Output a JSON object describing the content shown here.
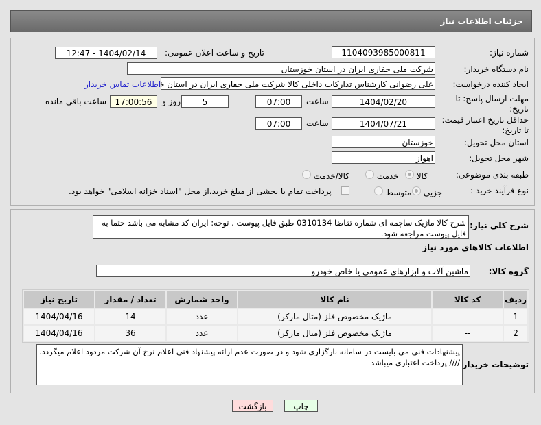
{
  "header": {
    "title": "جزئیات اطلاعات نیاز"
  },
  "form": {
    "need_number_label": "شماره نیاز:",
    "need_number": "1104093985000811",
    "announce_label": "تاریخ و ساعت اعلان عمومی:",
    "announce_value": "1404/02/14 - 12:47",
    "buyer_label": "نام دستگاه خریدار:",
    "buyer_value": "شرکت ملی حفاری ایران در استان خوزستان",
    "creator_label": "ایجاد کننده درخواست:",
    "creator_value": "علی رضوانی کارشناس تدارکات داخلی  کالا شرکت ملی حفاری ایران در استان خوزستان",
    "contact_link": "اطلاعات تماس خریدار",
    "deadline_label": "مهلت ارسال پاسخ: تا تاریخ:",
    "deadline_date": "1404/02/20",
    "hour_label": "ساعت",
    "deadline_time": "07:00",
    "days": "5",
    "days_label": "روز و",
    "remaining": "17:00:56",
    "remaining_label": "ساعت باقي مانده",
    "validity_label": "حداقل تاریخ اعتبار قیمت: تا تاریخ:",
    "validity_date": "1404/07/21",
    "validity_time": "07:00",
    "province_label": "استان محل تحویل:",
    "province": "خوزستان",
    "city_label": "شهر محل تحویل:",
    "city": "اهواز",
    "category_label": "طبقه بندی موضوعی:",
    "category_options": [
      "کالا",
      "خدمت",
      "کالا/خدمت"
    ],
    "process_label": "نوع فرآیند خرید :",
    "process_options": [
      "جزیی",
      "متوسط"
    ],
    "payment_note": "پرداخت تمام یا بخشی از مبلغ خرید،از محل \"اسناد خزانه اسلامی\" خواهد بود."
  },
  "description": {
    "label": "شرح کلي نياز:",
    "value": "شرح کالا ماژیک ساچمه ای شماره تقاضا 0310134 طبق فایل پیوست . توجه: ایران کد مشابه می باشد حتما به فایل پیوست مراجعه شود."
  },
  "goods": {
    "title": "اطلاعات کالاهاي مورد نياز",
    "group_label": "گروه کالا:",
    "group_value": "ماشین آلات و ابزارهای عمومی یا خاص خودرو",
    "columns": [
      "ردیف",
      "کد کالا",
      "نام کالا",
      "واحد شمارش",
      "تعداد / مقدار",
      "تاریخ نیاز"
    ],
    "rows": [
      [
        "1",
        "--",
        "ماژیک مخصوص فلز (متال مارکر)",
        "عدد",
        "14",
        "1404/04/16"
      ],
      [
        "2",
        "--",
        "ماژیک مخصوص فلز (متال مارکر)",
        "عدد",
        "36",
        "1404/04/16"
      ]
    ]
  },
  "notes": {
    "label": "توضیحات خریدار:",
    "value": "پیشنهادات فنی می بایست در سامانه بارگزاری شود و در صورت عدم ارائه پیشنهاد فنی اعلام نرخ آن شرکت مردود اعلام میگردد.  //// پرداخت اعتباری میباشد"
  },
  "buttons": {
    "back": "بازگشت",
    "print": "چاپ"
  },
  "colors": {
    "back_bg": "#ffdcdc",
    "print_bg": "#e6ffe6",
    "remaining_bg": "#ffffe6",
    "link": "#2222cc"
  }
}
